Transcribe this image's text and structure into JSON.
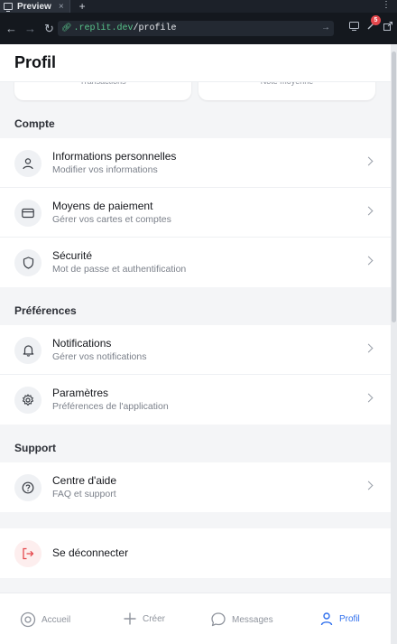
{
  "browser": {
    "tab_title": "Preview",
    "tab_close": "×",
    "tab_new": "+",
    "more": "⋮",
    "url_host": ".replit.dev",
    "url_path": "/profile",
    "notification_count": "5"
  },
  "app": {
    "title": "Profil",
    "stats": [
      {
        "label": "Transactions"
      },
      {
        "label": "Note moyenne"
      }
    ],
    "sections": [
      {
        "title": "Compte",
        "items": [
          {
            "title": "Informations personnelles",
            "subtitle": "Modifier vos informations",
            "icon": "user-icon"
          },
          {
            "title": "Moyens de paiement",
            "subtitle": "Gérer vos cartes et comptes",
            "icon": "credit-card-icon"
          },
          {
            "title": "Sécurité",
            "subtitle": "Mot de passe et authentification",
            "icon": "shield-icon"
          }
        ]
      },
      {
        "title": "Préférences",
        "items": [
          {
            "title": "Notifications",
            "subtitle": "Gérer vos notifications",
            "icon": "bell-icon"
          },
          {
            "title": "Paramètres",
            "subtitle": "Préférences de l'application",
            "icon": "gear-icon"
          }
        ]
      },
      {
        "title": "Support",
        "items": [
          {
            "title": "Centre d'aide",
            "subtitle": "FAQ et support",
            "icon": "help-circle-icon"
          }
        ]
      }
    ],
    "logout_label": "Se déconnecter",
    "nav": [
      {
        "label": "Accueil",
        "icon": "home-icon",
        "active": false
      },
      {
        "label": "Créer",
        "icon": "plus-icon",
        "active": false
      },
      {
        "label": "Messages",
        "icon": "message-icon",
        "active": false
      },
      {
        "label": "Profil",
        "icon": "user-icon",
        "active": true
      }
    ],
    "colors": {
      "accent": "#2f6fed",
      "danger": "#e5484d",
      "background": "#f4f5f7"
    }
  }
}
